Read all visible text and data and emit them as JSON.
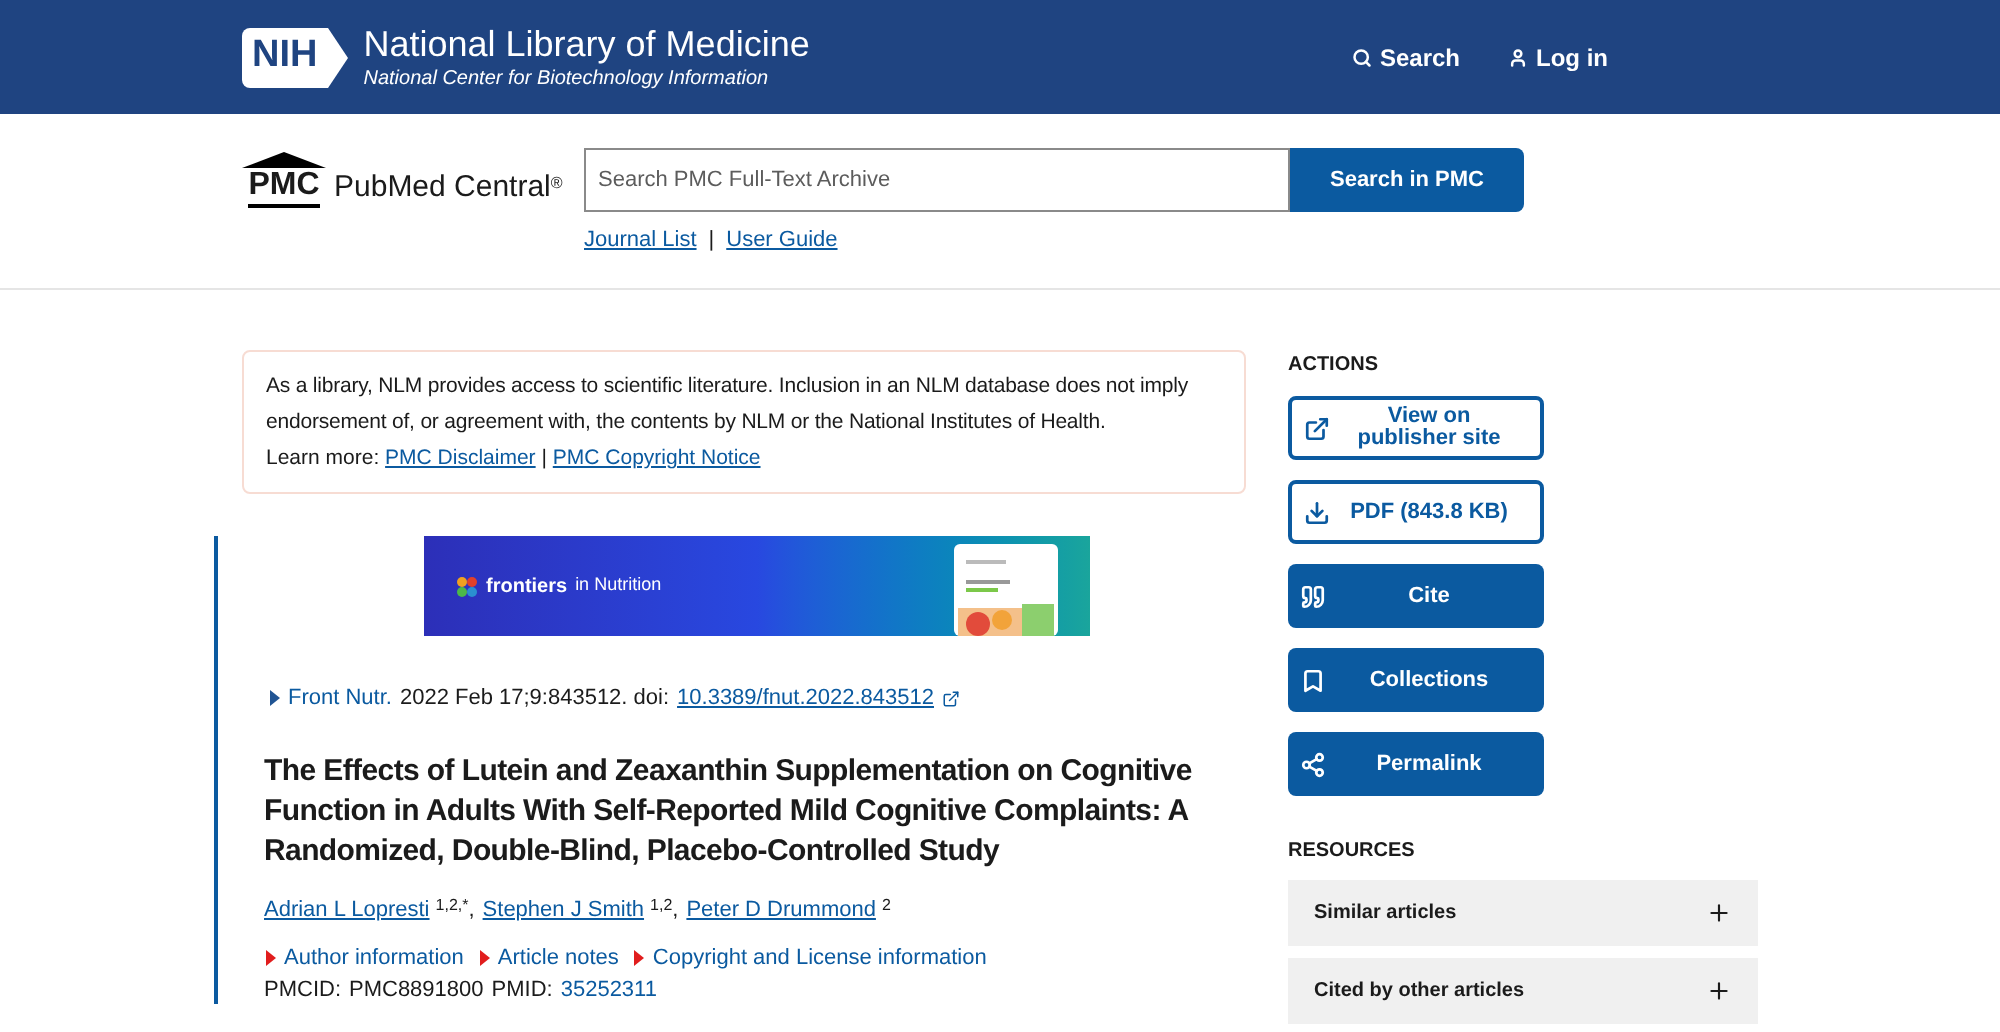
{
  "header": {
    "logo_mark": "NIH",
    "title": "National Library of Medicine",
    "subtitle": "National Center for Biotechnology Information",
    "links": [
      {
        "kind": "search",
        "label": "Search"
      },
      {
        "kind": "user",
        "label": "Log in"
      }
    ]
  },
  "masthead": {
    "logo_mark": "PMC",
    "logo_text": "PubMed Central",
    "logo_sup": "®",
    "search": {
      "placeholder": "Search PMC Full-Text Archive"
    },
    "search_button": "Search in PMC",
    "links": [
      {
        "label": "Journal List"
      },
      {
        "label": "User Guide"
      }
    ],
    "separator": "|"
  },
  "notice": {
    "text": "As a library, NLM provides access to scientific literature. Inclusion in an NLM database does not imply endorsement of, or agreement with, the contents by NLM or the National Institutes of Health.",
    "learn_more": "Learn more:",
    "links": [
      "PMC Disclaimer",
      "PMC Copyright Notice"
    ],
    "separator": "|"
  },
  "banner": {
    "brand": "frontiers",
    "subtitle": "in Nutrition"
  },
  "citation": {
    "journal": "Front Nutr.",
    "details": "2022 Feb 17;9:843512. doi:",
    "doi": "10.3389/fnut.2022.843512"
  },
  "article": {
    "title": "The Effects of Lutein and Zeaxanthin Supplementation on Cognitive Function in Adults With Self-Reported Mild Cognitive Complaints: A Randomized, Double-Blind, Placebo-Controlled Study",
    "author_separator": ",",
    "authors": [
      {
        "name": "Adrian L Lopresti",
        "affiliations": "1,2,*"
      },
      {
        "name": "Stephen J Smith",
        "affiliations": "1,2"
      },
      {
        "name": "Peter D Drummond",
        "affiliations": "2"
      }
    ],
    "info_links": [
      {
        "label": "Author information",
        "expanded": false
      },
      {
        "label": "Article notes",
        "expanded": false
      },
      {
        "label": "Copyright and License information",
        "expanded": false
      }
    ],
    "ids": {
      "pmcid_label": "PMCID:",
      "pmcid": "PMC8891800",
      "pmid_label": "PMID:",
      "pmid": "35252311"
    }
  },
  "actions": {
    "heading": "ACTIONS",
    "buttons": [
      {
        "kind": "external",
        "label": "View on publisher site",
        "primary": false
      },
      {
        "kind": "download",
        "label": "PDF (843.8 KB)",
        "primary": false
      },
      {
        "kind": "quote",
        "label": "Cite",
        "primary": true
      },
      {
        "kind": "bookmark",
        "label": "Collections",
        "primary": true
      },
      {
        "kind": "share",
        "label": "Permalink",
        "primary": true
      }
    ]
  },
  "resources": {
    "heading": "RESOURCES",
    "items": [
      {
        "label": "Similar articles",
        "expanded": false
      },
      {
        "label": "Cited by other articles",
        "expanded": false
      }
    ]
  }
}
